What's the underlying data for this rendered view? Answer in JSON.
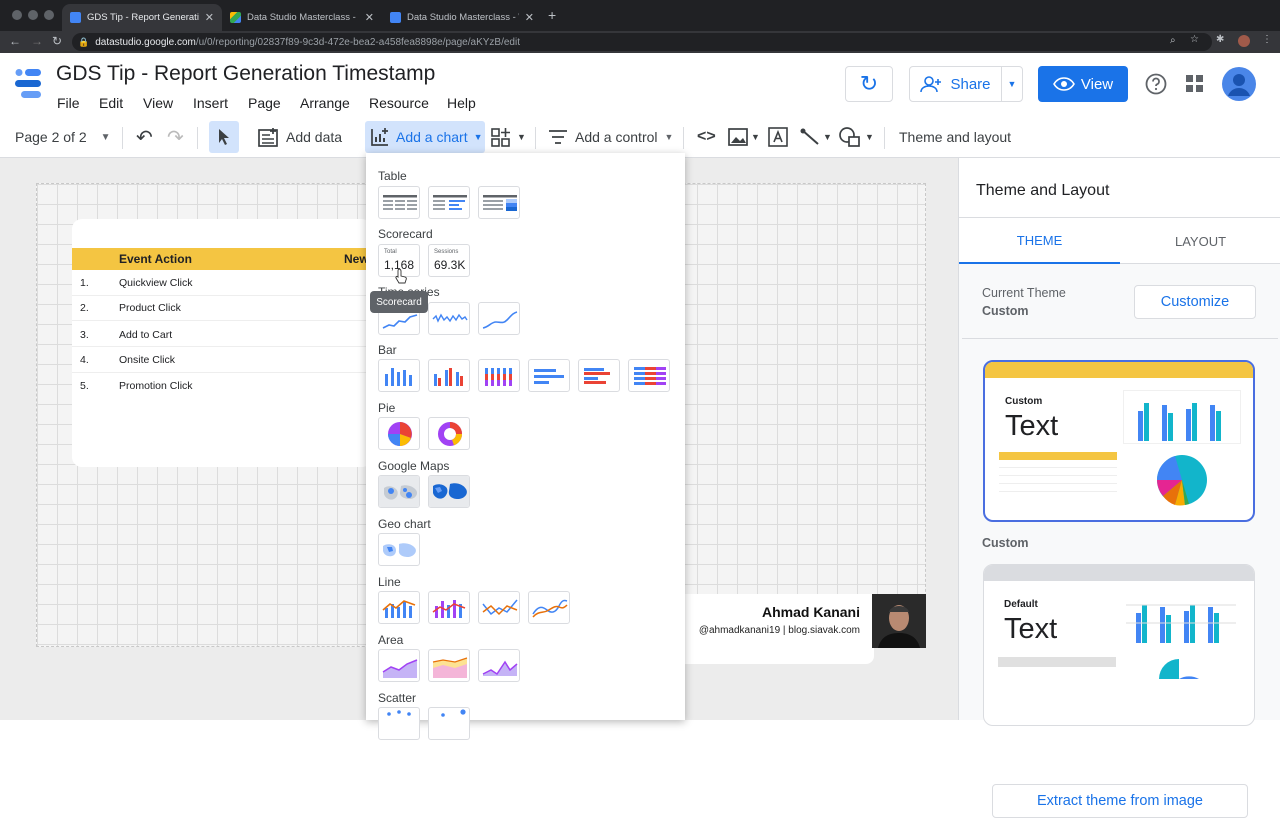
{
  "browser": {
    "tabs": [
      {
        "title": "GDS Tip - Report Generation Timestamp",
        "active": true
      },
      {
        "title": "Data Studio Masterclass - Man",
        "active": false
      },
      {
        "title": "Data Studio Masterclass - Web",
        "active": false
      }
    ],
    "new_tab": "+",
    "url_host": "datastudio.google.com",
    "url_path": "/u/0/reporting/02837f89-9c3d-472e-bea2-a458fea8898e/page/aKYzB/edit"
  },
  "app": {
    "title": "GDS Tip - Report Generation Timestamp",
    "menu": [
      "File",
      "Edit",
      "View",
      "Insert",
      "Page",
      "Arrange",
      "Resource",
      "Help"
    ],
    "share_label": "Share",
    "view_label": "View"
  },
  "toolbar": {
    "page_indicator": "Page 2 of 2",
    "add_data": "Add data",
    "add_chart": "Add a chart",
    "add_control": "Add a control",
    "theme_layout": "Theme and layout"
  },
  "report_table": {
    "header": [
      "Event Action",
      "New"
    ],
    "rows": [
      {
        "num": "1.",
        "label": "Quickview Click"
      },
      {
        "num": "2.",
        "label": "Product Click"
      },
      {
        "num": "3.",
        "label": "Add to Cart"
      },
      {
        "num": "4.",
        "label": "Onsite Click"
      },
      {
        "num": "5.",
        "label": "Promotion Click"
      }
    ],
    "header_color": "#f4c542"
  },
  "chart_menu": {
    "sections": [
      "Table",
      "Scorecard",
      "Time series",
      "Bar",
      "Pie",
      "Google Maps",
      "Geo chart",
      "Line",
      "Area",
      "Scatter"
    ],
    "scorecard1": {
      "label": "Total",
      "value": "1,168"
    },
    "scorecard2": {
      "label": "Sessions",
      "value": "69.3K"
    },
    "tooltip": "Scorecard"
  },
  "signature": {
    "name": "Ahmad Kanani",
    "handle": "@ahmadkanani19 | blog.siavak.com"
  },
  "panel": {
    "title": "Theme and Layout",
    "tabs": [
      "THEME",
      "LAYOUT"
    ],
    "current_theme_label": "Current Theme",
    "current_theme_value": "Custom",
    "customize": "Customize",
    "theme1": {
      "small": "Custom",
      "big": "Text",
      "caption": "Custom"
    },
    "theme2": {
      "small": "Default",
      "big": "Text"
    },
    "extract": "Extract theme from image"
  },
  "colors": {
    "accent": "#1a73e8",
    "yellow": "#f4c542"
  }
}
